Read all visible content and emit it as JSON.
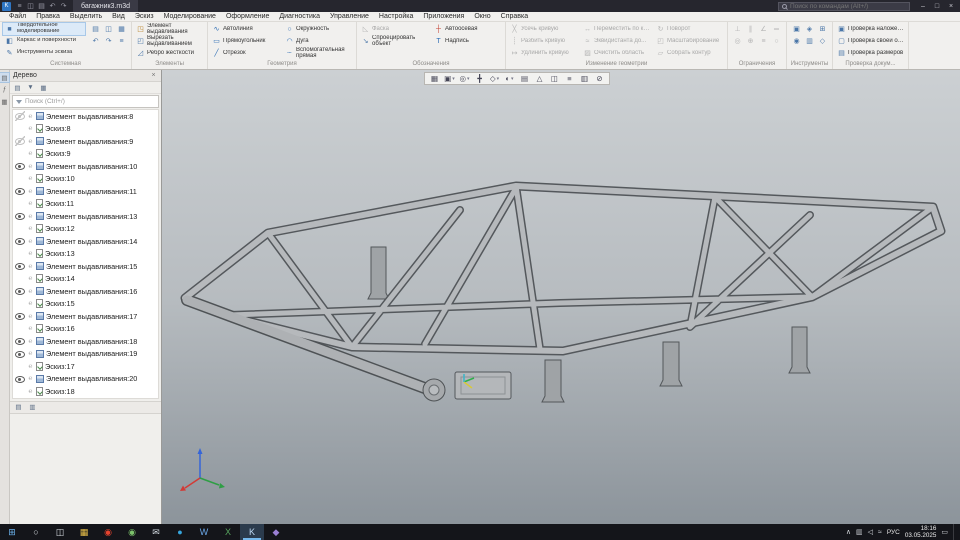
{
  "window": {
    "title": "багажник3.m3d",
    "search_placeholder": "Поиск по командам (Alt+/)",
    "quick_icons": [
      {
        "name": "app-menu-icon",
        "glyph": "≡"
      },
      {
        "name": "save-icon",
        "glyph": "◫"
      },
      {
        "name": "open-icon",
        "glyph": "▤"
      },
      {
        "name": "undo-icon",
        "glyph": "↶"
      },
      {
        "name": "redo-icon",
        "glyph": "↷"
      }
    ],
    "controls": [
      {
        "name": "minimize-button",
        "glyph": "–"
      },
      {
        "name": "maximize-button",
        "glyph": "□"
      },
      {
        "name": "close-button",
        "glyph": "×"
      }
    ]
  },
  "menu": {
    "items": [
      "Файл",
      "Правка",
      "Выделить",
      "Вид",
      "Эскиз",
      "Моделирование",
      "Оформление",
      "Диагностика",
      "Управление",
      "Настройка",
      "Приложения",
      "Окно",
      "Справка"
    ]
  },
  "ribbon": {
    "active_mode": 0,
    "groups": [
      {
        "label": "Системная",
        "modes": [
          {
            "name": "mode-solid-modeling",
            "label": "Твердотельное моделирование",
            "glyph": "■"
          },
          {
            "name": "mode-wireframe-surfaces",
            "label": "Каркас и поверхности",
            "glyph": "◧"
          },
          {
            "name": "mode-sketch-tools",
            "label": "Инструменты эскиза",
            "glyph": "✎"
          }
        ],
        "icons": [
          {
            "name": "open-document",
            "glyph": "▤"
          },
          {
            "name": "save-document",
            "glyph": "◫"
          },
          {
            "name": "print-document",
            "glyph": "▦"
          },
          {
            "name": "undo",
            "glyph": "↶"
          },
          {
            "name": "redo",
            "glyph": "↷"
          },
          {
            "name": "system-more",
            "glyph": "≡"
          }
        ]
      },
      {
        "label": "Элементы",
        "cols": [
          [
            {
              "name": "extrude-element",
              "label": "Элемент выдавливания",
              "glyph": "◳",
              "color": "#b9852c",
              "wrap": true
            },
            {
              "name": "cut-extrude",
              "label": "Вырезать выдавливанием",
              "glyph": "◰",
              "color": "#4a76a8",
              "wrap": true
            },
            {
              "name": "stiffener-rib",
              "label": "Ребро жесткости",
              "glyph": "◿",
              "color": "#4a76a8",
              "wrap": true
            }
          ]
        ]
      },
      {
        "label": "Геометрия",
        "cols": [
          [
            {
              "name": "autoline",
              "label": "Автолиния",
              "glyph": "∿",
              "color": "#2e6db4"
            },
            {
              "name": "rectangle",
              "label": "Прямоугольник",
              "glyph": "▭",
              "color": "#2e6db4"
            },
            {
              "name": "segment",
              "label": "Отрезок",
              "glyph": "╱",
              "color": "#2e6db4"
            }
          ],
          [
            {
              "name": "circle",
              "label": "Окружность",
              "glyph": "○",
              "color": "#2e6db4"
            },
            {
              "name": "arc",
              "label": "Дуга",
              "glyph": "◠",
              "color": "#2e6db4"
            },
            {
              "name": "auxiliary-line",
              "label": "Вспомогательная прямая",
              "glyph": "┄",
              "color": "#2e6db4",
              "wrap": true
            }
          ]
        ]
      },
      {
        "label": "Обозначения",
        "cols": [
          [
            {
              "name": "chamfer",
              "label": "Фаска",
              "glyph": "◺",
              "enabled": false
            },
            {
              "name": "project-object",
              "label": "Спроецировать объект",
              "glyph": "↘",
              "color": "#4a76a8",
              "wrap": true
            }
          ],
          [
            {
              "name": "auto-centerline",
              "label": "Автоосевая",
              "glyph": "┼",
              "color": "#c23b2e"
            },
            {
              "name": "text-label",
              "label": "Надпись",
              "glyph": "T",
              "color": "#2e6db4"
            }
          ]
        ]
      },
      {
        "label": "Изменение геометрии",
        "disabled": true,
        "cols": [
          [
            {
              "name": "trim-curve",
              "label": "Усечь кривую",
              "glyph": "╳"
            },
            {
              "name": "split-curve",
              "label": "Разбить кривую",
              "glyph": "┊"
            },
            {
              "name": "extend-curve",
              "label": "Удлинить кривую",
              "glyph": "↦"
            }
          ],
          [
            {
              "name": "move-by-coordinates",
              "label": "Переместить по коорд...",
              "glyph": "↔"
            },
            {
              "name": "equidistant",
              "label": "Эквидистанта до...",
              "glyph": "≈"
            },
            {
              "name": "clear-area",
              "label": "Очистить область",
              "glyph": "▨"
            }
          ],
          [
            {
              "name": "rotate-geometry",
              "label": "Поворот",
              "glyph": "↻"
            },
            {
              "name": "scale-geometry",
              "label": "Масштабирование",
              "glyph": "◰"
            },
            {
              "name": "collect-contour",
              "label": "Собрать контур",
              "glyph": "▱"
            }
          ]
        ]
      },
      {
        "label": "Ограничения",
        "disabled": true,
        "icons": [
          {
            "name": "constraint-perpendicular",
            "glyph": "⊥"
          },
          {
            "name": "constraint-parallel",
            "glyph": "∥"
          },
          {
            "name": "constraint-angle",
            "glyph": "∠"
          },
          {
            "name": "constraint-horizontal",
            "glyph": "═"
          },
          {
            "name": "constraint-concentric",
            "glyph": "◎"
          },
          {
            "name": "constraint-coincident",
            "glyph": "⊕"
          },
          {
            "name": "constraint-equal",
            "glyph": "≡"
          },
          {
            "name": "constraint-tangent",
            "glyph": "○"
          }
        ]
      },
      {
        "label": "Инструменты",
        "icons": [
          {
            "name": "tool-macro",
            "glyph": "▣"
          },
          {
            "name": "tool-variables",
            "glyph": "◈"
          },
          {
            "name": "tool-measure",
            "glyph": "⊞"
          },
          {
            "name": "tool-check",
            "glyph": "◉"
          },
          {
            "name": "tool-report",
            "glyph": "▥"
          },
          {
            "name": "tool-library",
            "glyph": "◇"
          }
        ]
      },
      {
        "label": "Проверка докум...",
        "cols": [
          [
            {
              "name": "check-overlap",
              "label": "Проверка наложения эл...",
              "glyph": "▣",
              "color": "#4a76a8"
            },
            {
              "name": "check-annotations",
              "label": "Проверка своей обозна...",
              "glyph": "▢",
              "color": "#4a76a8"
            },
            {
              "name": "check-dimensions",
              "label": "Проверка размеров",
              "glyph": "▤",
              "color": "#4a76a8"
            }
          ]
        ]
      }
    ]
  },
  "side_strip": {
    "icons": [
      {
        "name": "panel-tree-toggle",
        "glyph": "▤",
        "active": true
      },
      {
        "name": "panel-parameters-toggle",
        "glyph": "ƒ",
        "active": false
      },
      {
        "name": "panel-libraries-toggle",
        "glyph": "▦",
        "active": false
      }
    ]
  },
  "tree": {
    "title": "Дерево",
    "search_placeholder": "Поиск (Ctrl+/)",
    "tools": [
      {
        "name": "tree-structure-button",
        "glyph": "▤"
      },
      {
        "name": "tree-filter-button",
        "glyph": "▼"
      },
      {
        "name": "tree-settings-button",
        "glyph": "▦"
      }
    ],
    "footer": [
      {
        "name": "tree-tab-model",
        "glyph": "▤"
      },
      {
        "name": "tree-tab-execution",
        "glyph": "▥"
      }
    ],
    "rows": [
      {
        "type": "feature",
        "label": "Элемент выдавливания:8",
        "eye": "off"
      },
      {
        "type": "sketch",
        "label": "Эскиз:8"
      },
      {
        "type": "feature",
        "label": "Элемент выдавливания:9",
        "eye": "off"
      },
      {
        "type": "sketch",
        "label": "Эскиз:9"
      },
      {
        "type": "feature",
        "label": "Элемент выдавливания:10",
        "eye": "on"
      },
      {
        "type": "sketch",
        "label": "Эскиз:10"
      },
      {
        "type": "feature",
        "label": "Элемент выдавливания:11",
        "eye": "on"
      },
      {
        "type": "sketch",
        "label": "Эскиз:11"
      },
      {
        "type": "feature",
        "label": "Элемент выдавливания:13",
        "eye": "on"
      },
      {
        "type": "sketch",
        "label": "Эскиз:12"
      },
      {
        "type": "feature",
        "label": "Элемент выдавливания:14",
        "eye": "on"
      },
      {
        "type": "sketch",
        "label": "Эскиз:13"
      },
      {
        "type": "feature",
        "label": "Элемент выдавливания:15",
        "eye": "on"
      },
      {
        "type": "sketch",
        "label": "Эскиз:14"
      },
      {
        "type": "feature",
        "label": "Элемент выдавливания:16",
        "eye": "on"
      },
      {
        "type": "sketch",
        "label": "Эскиз:15"
      },
      {
        "type": "feature",
        "label": "Элемент выдавливания:17",
        "eye": "on"
      },
      {
        "type": "sketch",
        "label": "Эскиз:16"
      },
      {
        "type": "feature",
        "label": "Элемент выдавливания:18",
        "eye": "on"
      },
      {
        "type": "feature",
        "label": "Элемент выдавливания:19",
        "eye": "on"
      },
      {
        "type": "sketch",
        "label": "Эскиз:17"
      },
      {
        "type": "feature",
        "label": "Элемент выдавливания:20",
        "eye": "on"
      },
      {
        "type": "sketch",
        "label": "Эскиз:18"
      }
    ]
  },
  "viewport": {
    "toolbar": [
      {
        "name": "control-grid-button",
        "glyph": "▦"
      },
      {
        "name": "selection-filter-button",
        "glyph": "▣",
        "dropdown": true
      },
      {
        "name": "zoom-tools-button",
        "glyph": "◎",
        "dropdown": true
      },
      {
        "name": "pan-button",
        "glyph": "╋"
      },
      {
        "name": "orientation-button",
        "glyph": "◇",
        "dropdown": true
      },
      {
        "name": "display-mode-button",
        "glyph": "◐",
        "dropdown": true
      },
      {
        "name": "hidden-lines-button",
        "glyph": "▤"
      },
      {
        "name": "perspective-button",
        "glyph": "△"
      },
      {
        "name": "section-view-button",
        "glyph": "◫"
      },
      {
        "name": "simplification-button",
        "glyph": "≡"
      },
      {
        "name": "image-quality-button",
        "glyph": "▥"
      },
      {
        "name": "scene-settings-button",
        "glyph": "⊘"
      }
    ],
    "model_color": "#b6b9bc",
    "edge_color": "#54585c",
    "axis_colors": {
      "x": "#d23a36",
      "y": "#2f9e45",
      "z": "#3565d8"
    }
  },
  "taskbar": {
    "language": "РУС",
    "clock": {
      "time": "18:16",
      "date": "03.05.2025"
    },
    "apps": [
      {
        "name": "start-button",
        "glyph": "⊞",
        "color": "#6db4ef"
      },
      {
        "name": "search-button",
        "glyph": "○",
        "color": "#d8dde2"
      },
      {
        "name": "task-view-button",
        "glyph": "◫",
        "color": "#d8dde2"
      },
      {
        "name": "file-explorer",
        "glyph": "▦",
        "color": "#eac049"
      },
      {
        "name": "browser-red",
        "glyph": "◉",
        "color": "#e8432e"
      },
      {
        "name": "browser-chrome",
        "glyph": "◉",
        "color": "#7cc26b"
      },
      {
        "name": "mail-app",
        "glyph": "✉",
        "color": "#cfd6dd"
      },
      {
        "name": "messenger-app",
        "glyph": "●",
        "color": "#36a6de"
      },
      {
        "name": "word-app",
        "glyph": "W",
        "color": "#6aa7e8"
      },
      {
        "name": "excel-app",
        "glyph": "X",
        "color": "#57a45e"
      },
      {
        "name": "kompas-3d-app",
        "glyph": "K",
        "color": "#bcd7f2",
        "active": true
      },
      {
        "name": "photos-app",
        "glyph": "◆",
        "color": "#9a7fd4"
      }
    ],
    "tray": [
      {
        "name": "tray-expand",
        "glyph": "∧"
      },
      {
        "name": "tray-shield",
        "glyph": "▥"
      },
      {
        "name": "tray-volume",
        "glyph": "◁"
      },
      {
        "name": "tray-network",
        "glyph": "≈"
      }
    ],
    "notification_glyph": "▭"
  }
}
